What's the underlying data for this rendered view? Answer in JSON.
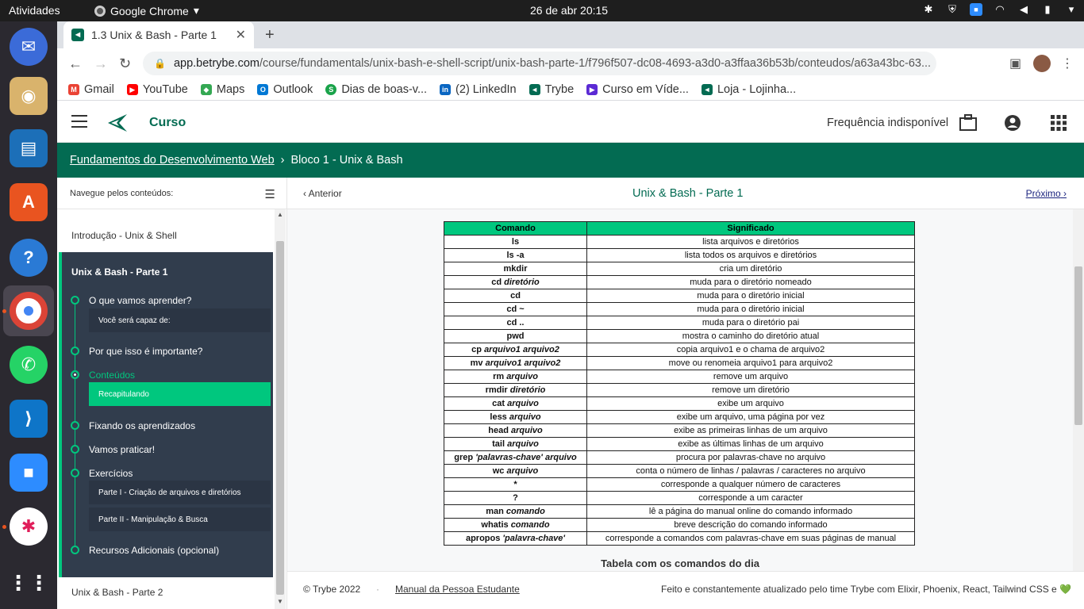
{
  "system": {
    "activities": "Atividades",
    "app_name": "Google Chrome",
    "clock": "26 de abr  20:15"
  },
  "browser": {
    "tab_title": "1.3 Unix & Bash - Parte 1",
    "url_host": "app.betrybe.com",
    "url_path": "/course/fundamentals/unix-bash-e-shell-script/unix-bash-parte-1/f796f507-dc08-4693-a3d0-a3ffaa36b53b/conteudos/a63a43bc-63...",
    "bookmarks": [
      {
        "label": "Gmail",
        "icon": "gmail-icon",
        "color": "#ea4335",
        "glyph": "M"
      },
      {
        "label": "YouTube",
        "icon": "youtube-icon",
        "color": "#ff0000",
        "glyph": "▶"
      },
      {
        "label": "Maps",
        "icon": "maps-icon",
        "color": "#34a853",
        "glyph": "◆"
      },
      {
        "label": "Outlook",
        "icon": "outlook-icon",
        "color": "#0078d4",
        "glyph": "O"
      },
      {
        "label": "Dias de boas-v...",
        "icon": "slack-style-icon",
        "color": "#1aa34a",
        "glyph": "S"
      },
      {
        "label": "(2) LinkedIn",
        "icon": "linkedin-icon",
        "color": "#0a66c2",
        "glyph": "in"
      },
      {
        "label": "Trybe",
        "icon": "trybe-icon",
        "color": "#036b52",
        "glyph": "◄"
      },
      {
        "label": "Curso em Víde...",
        "icon": "curso-em-video-icon",
        "color": "#5b2ad4",
        "glyph": "▶"
      },
      {
        "label": "Loja - Lojinha...",
        "icon": "trybe-icon",
        "color": "#036b52",
        "glyph": "◄"
      }
    ]
  },
  "site": {
    "header_title": "Curso",
    "frequency": "Frequência indisponível",
    "accent": "#036b52",
    "highlight": "#00c77e"
  },
  "breadcrumb": {
    "course": "Fundamentos do Desenvolvimento Web",
    "separator": "›",
    "block": "Bloco 1 - Unix & Bash"
  },
  "sidebar": {
    "heading": "Navegue pelos conteúdos:",
    "prev_module": "Introdução - Unix & Shell",
    "active_module": "Unix & Bash - Parte 1",
    "next_module": "Unix & Bash - Parte 2",
    "sections": [
      {
        "label": "O que vamos aprender?"
      },
      {
        "label": "Você será capaz de:"
      },
      {
        "label": "Por que isso é importante?"
      },
      {
        "label": "Conteúdos"
      },
      {
        "label": "Recapitulando"
      },
      {
        "label": "Fixando os aprendizados"
      },
      {
        "label": "Vamos praticar!"
      },
      {
        "label": "Exercícios"
      },
      {
        "label": "Parte I - Criação de arquivos e diretórios"
      },
      {
        "label": "Parte II - Manipulação & Busca"
      },
      {
        "label": "Recursos Adicionais (opcional)"
      }
    ]
  },
  "lesson": {
    "prev": "Anterior",
    "title": "Unix & Bash - Parte 1",
    "next": "Próximo",
    "table_headers": [
      "Comando",
      "Significado"
    ],
    "table_rows": [
      {
        "cmd": "ls",
        "arg": "",
        "meaning": "lista arquivos e diretórios"
      },
      {
        "cmd": "ls -a",
        "arg": "",
        "meaning": "lista todos os arquivos e diretórios"
      },
      {
        "cmd": "mkdir",
        "arg": "",
        "meaning": "cria um diretório"
      },
      {
        "cmd": "cd",
        "arg": "diretório",
        "meaning": "muda para o diretório nomeado"
      },
      {
        "cmd": "cd",
        "arg": "",
        "meaning": "muda para o diretório inicial"
      },
      {
        "cmd": "cd ~",
        "arg": "",
        "meaning": "muda para o diretório inicial"
      },
      {
        "cmd": "cd ..",
        "arg": "",
        "meaning": "muda para o diretório pai"
      },
      {
        "cmd": "pwd",
        "arg": "",
        "meaning": "mostra o caminho do diretório atual"
      },
      {
        "cmd": "cp",
        "arg": "arquivo1 arquivo2",
        "meaning": "copia arquivo1 e o chama de arquivo2"
      },
      {
        "cmd": "mv",
        "arg": "arquivo1 arquivo2",
        "meaning": "move ou renomeia arquivo1 para arquivo2"
      },
      {
        "cmd": "rm",
        "arg": "arquivo",
        "meaning": "remove um arquivo"
      },
      {
        "cmd": "rmdir",
        "arg": "diretório",
        "meaning": "remove um diretório"
      },
      {
        "cmd": "cat",
        "arg": "arquivo",
        "meaning": "exibe um arquivo"
      },
      {
        "cmd": "less",
        "arg": "arquivo",
        "meaning": "exibe um arquivo, uma página por vez"
      },
      {
        "cmd": "head",
        "arg": "arquivo",
        "meaning": "exibe as primeiras linhas de um arquivo"
      },
      {
        "cmd": "tail",
        "arg": "arquivo",
        "meaning": "exibe as últimas linhas de um arquivo"
      },
      {
        "cmd": "grep",
        "arg": "'palavras-chave' arquivo",
        "meaning": "procura por palavras-chave no arquivo"
      },
      {
        "cmd": "wc",
        "arg": "arquivo",
        "meaning": "conta o número de linhas / palavras / caracteres no arquivo"
      },
      {
        "cmd": "*",
        "arg": "",
        "meaning": "corresponde a qualquer número de caracteres"
      },
      {
        "cmd": "?",
        "arg": "",
        "meaning": "corresponde a um caracter"
      },
      {
        "cmd": "man",
        "arg": "comando",
        "meaning": "lê a página do manual online do comando informado"
      },
      {
        "cmd": "whatis",
        "arg": "comando",
        "meaning": "breve descrição do comando informado"
      },
      {
        "cmd": "apropos",
        "arg": "'palavra-chave'",
        "meaning": "corresponde a comandos com palavras-chave em suas páginas de manual"
      }
    ],
    "caption": "Tabela com os comandos do dia"
  },
  "footer": {
    "copyright": "© Trybe 2022",
    "manual": "Manual da Pessoa Estudante",
    "made_by": "Feito e constantemente atualizado pelo time Trybe com Elixir, Phoenix, React, Tailwind CSS e 💚"
  }
}
